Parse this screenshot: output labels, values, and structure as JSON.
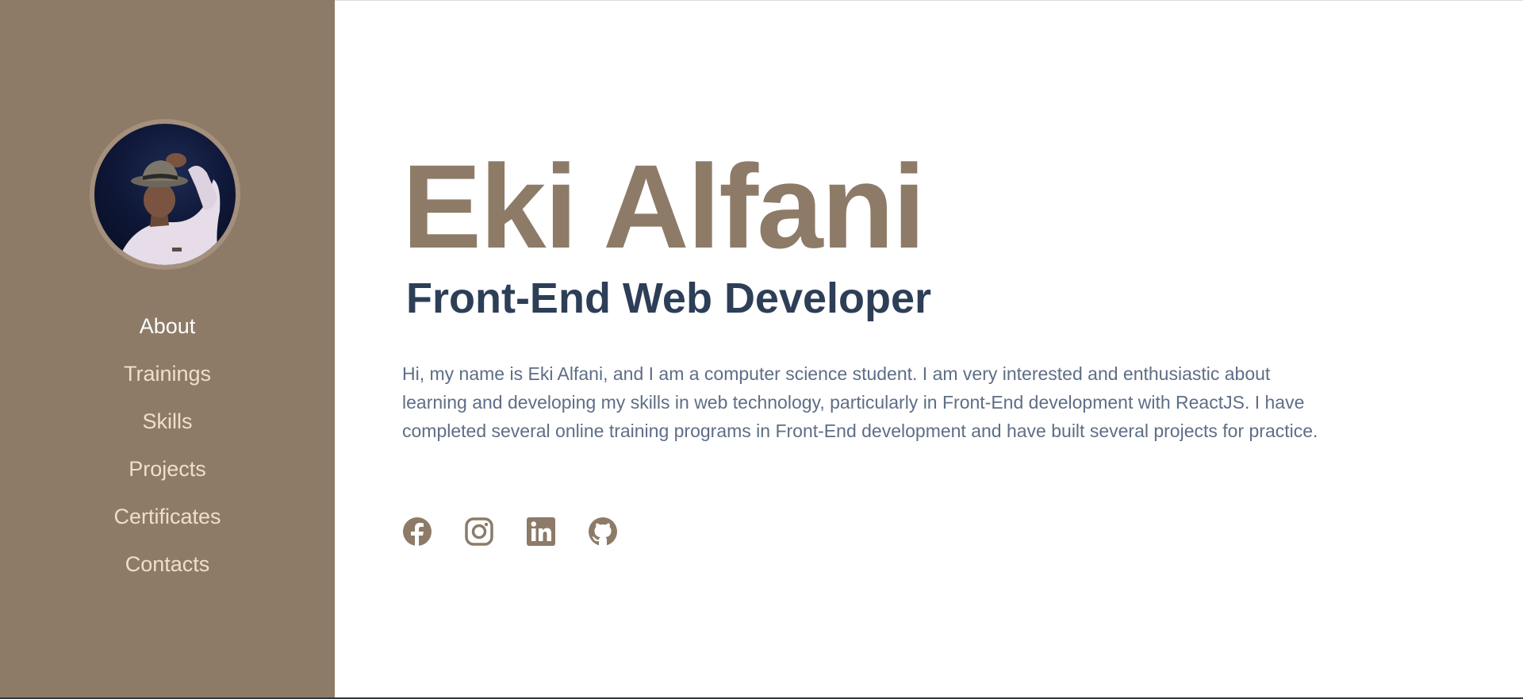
{
  "profile": {
    "name": "Eki Alfani",
    "role": "Front-End Web Developer",
    "bio": "Hi, my name is Eki Alfani, and I am a computer science student. I am very interested and enthusiastic about learning and developing my skills in web technology, particularly in Front-End development with ReactJS. I have completed several online training programs in Front-End development and have built several projects for practice."
  },
  "nav": {
    "items": [
      {
        "label": "About",
        "active": true
      },
      {
        "label": "Trainings",
        "active": false
      },
      {
        "label": "Skills",
        "active": false
      },
      {
        "label": "Projects",
        "active": false
      },
      {
        "label": "Certificates",
        "active": false
      },
      {
        "label": "Contacts",
        "active": false
      }
    ]
  },
  "socials": [
    {
      "icon": "facebook-icon"
    },
    {
      "icon": "instagram-icon"
    },
    {
      "icon": "linkedin-icon"
    },
    {
      "icon": "github-icon"
    }
  ],
  "colors": {
    "sidebar": "#8d7b68",
    "name": "#8d7b68",
    "role": "#2d3e57",
    "nav_text": "#f1dec9",
    "nav_active": "#ffffff",
    "bio": "#5e6e86"
  }
}
